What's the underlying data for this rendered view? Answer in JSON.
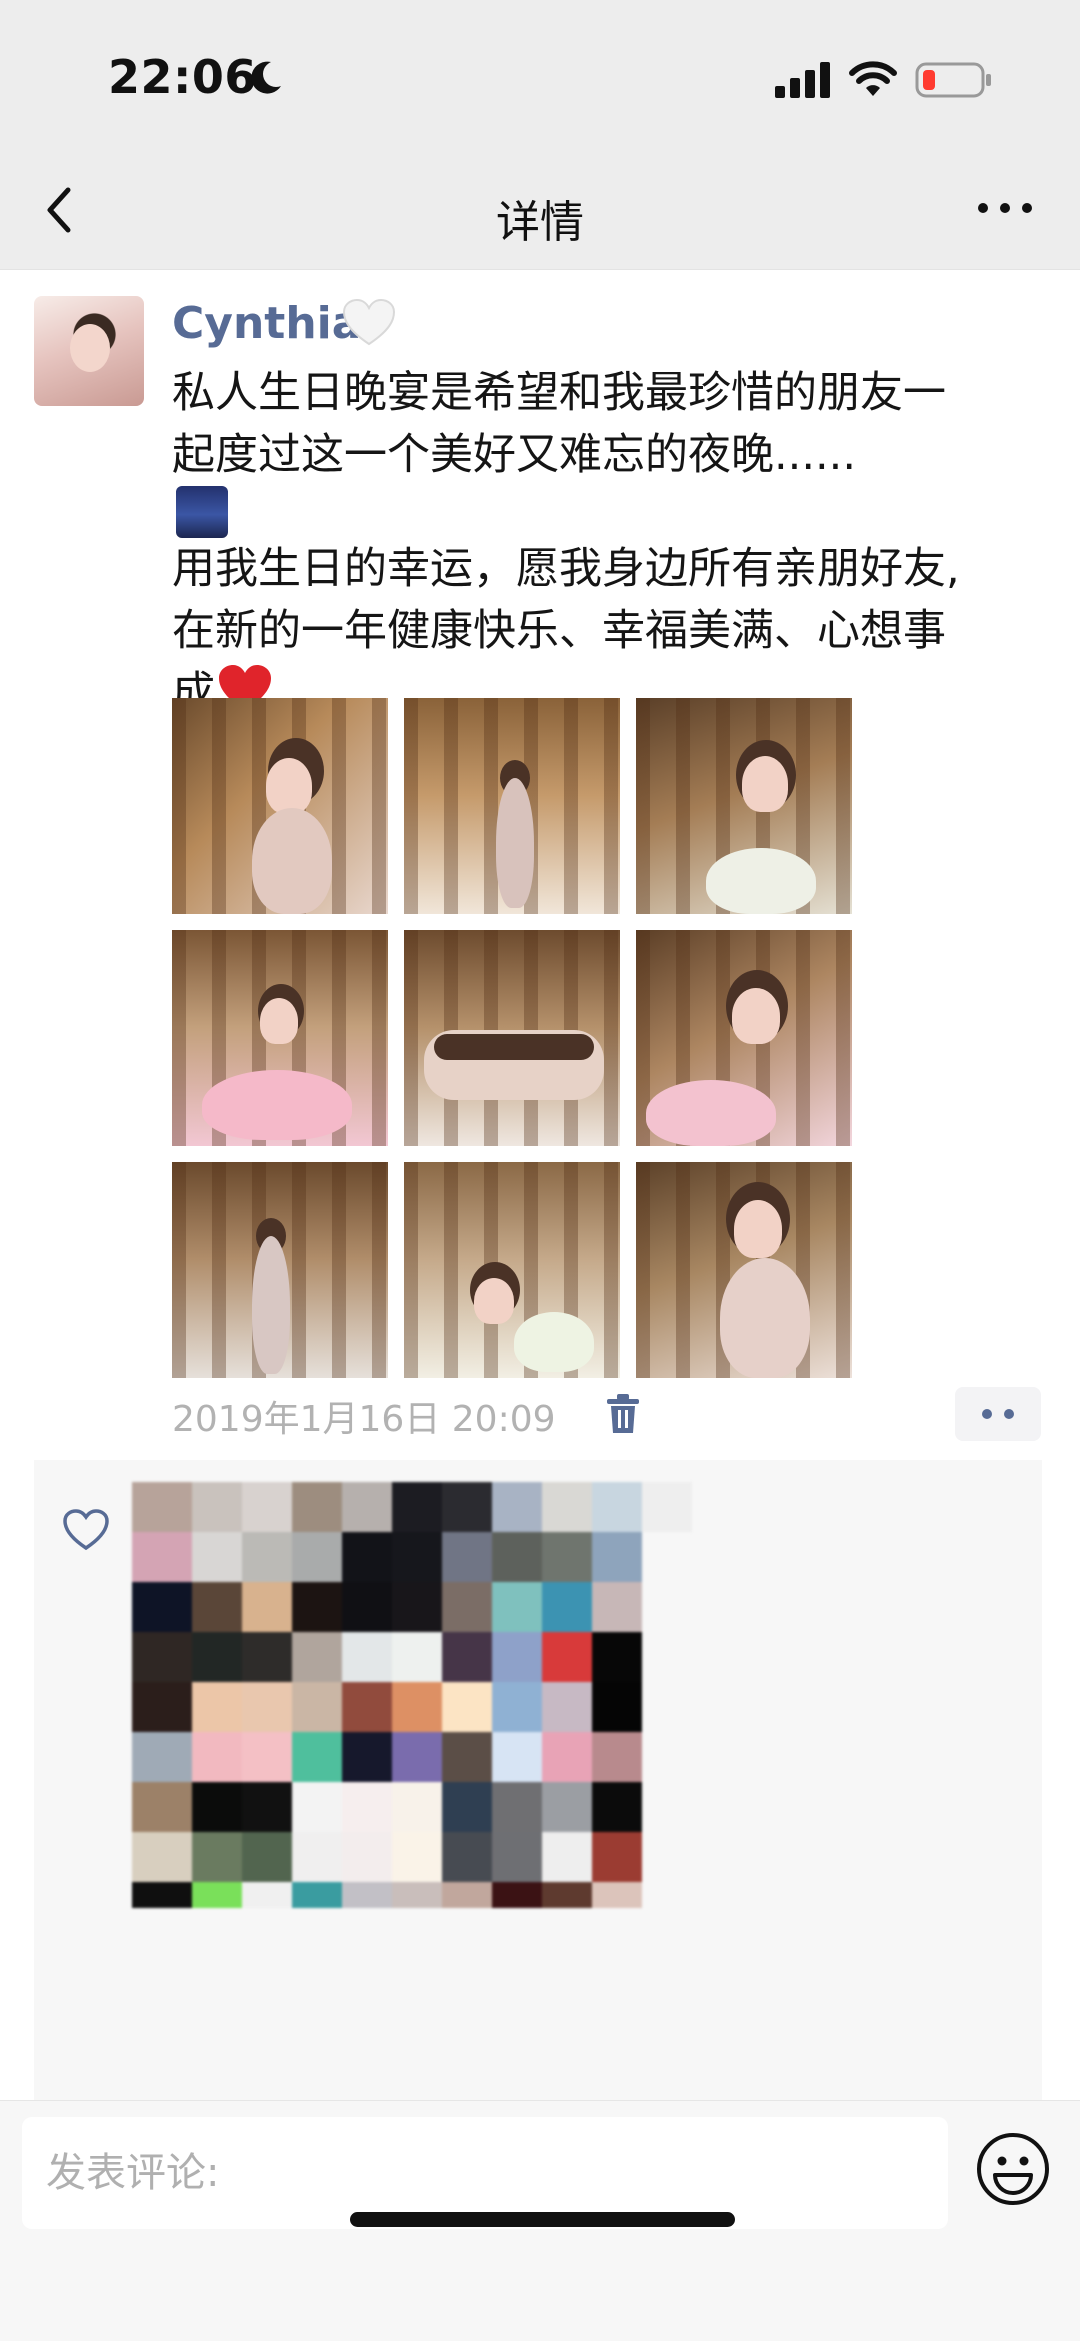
{
  "status_bar": {
    "time": "22:06"
  },
  "nav": {
    "title": "详情"
  },
  "post": {
    "username": "Cynthia",
    "text_lines": [
      "私人生日晚宴是希望和我最珍惜的朋友一",
      "起度过这一个美好又难忘的夜晚......",
      "用我生日的幸运，愿我身边所有亲朋好友,",
      "在新的一年健康快乐、幸福美满、心想事",
      "成"
    ],
    "timestamp": "2019年1月16日 20:09",
    "photo_count": 9
  },
  "comment": {
    "placeholder": "发表评论:"
  },
  "colors": {
    "link_blue": "#576b95",
    "meta_gray": "#b2b2b2",
    "bar_bg": "#ededed",
    "likes_bg": "#f7f7f7"
  },
  "icons": [
    "moon-icon",
    "signal-icon",
    "wifi-icon",
    "battery-icon",
    "back-icon",
    "more-icon",
    "white-heart-icon",
    "night-city-icon",
    "red-heart-icon",
    "trash-icon",
    "like-heart-icon",
    "smiley-icon"
  ]
}
